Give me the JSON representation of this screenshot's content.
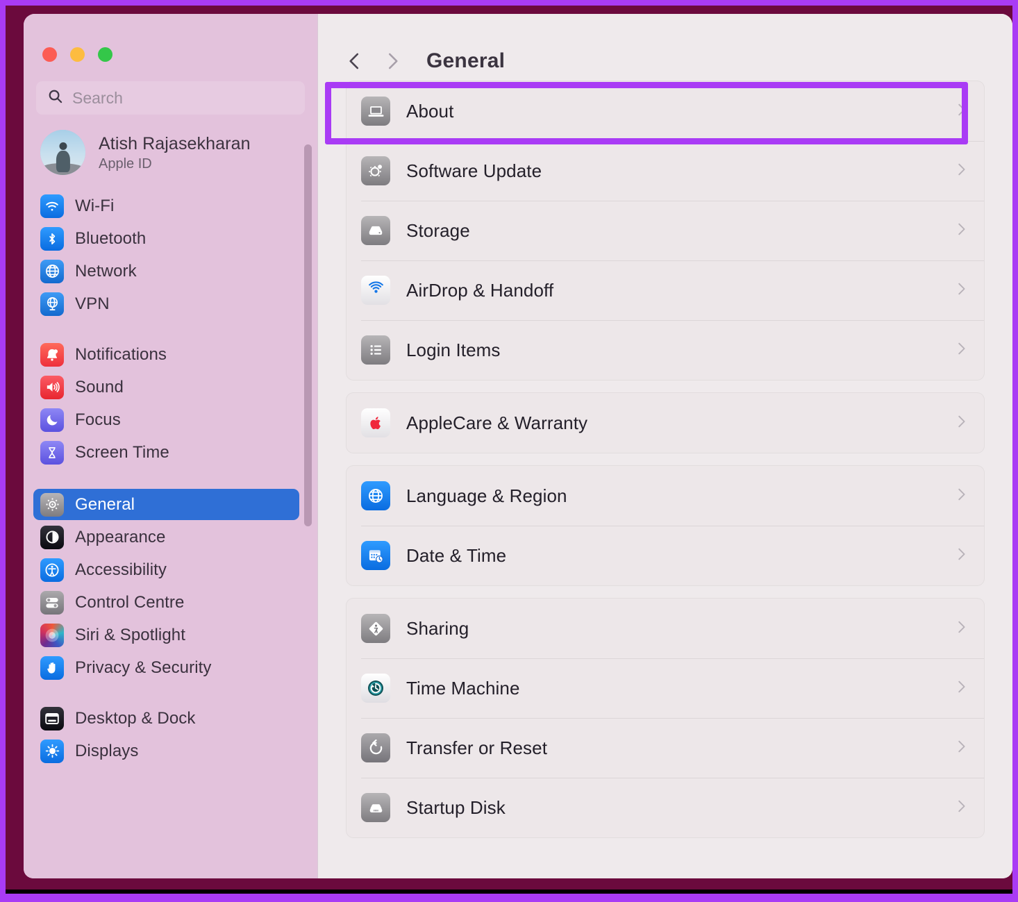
{
  "window": {
    "traffic_lights": [
      "close",
      "minimize",
      "zoom"
    ]
  },
  "sidebar": {
    "search": {
      "placeholder": "Search",
      "value": "",
      "icon": "search-icon"
    },
    "account": {
      "name": "Atish Rajasekharan",
      "subtitle": "Apple ID",
      "avatar_alt": "user-avatar"
    },
    "groups": [
      {
        "items": [
          {
            "label": "Wi-Fi",
            "icon": "wifi-icon"
          },
          {
            "label": "Bluetooth",
            "icon": "bluetooth-icon"
          },
          {
            "label": "Network",
            "icon": "globe-icon"
          },
          {
            "label": "VPN",
            "icon": "vpn-globe-icon"
          }
        ]
      },
      {
        "items": [
          {
            "label": "Notifications",
            "icon": "bell-icon"
          },
          {
            "label": "Sound",
            "icon": "speaker-icon"
          },
          {
            "label": "Focus",
            "icon": "moon-icon"
          },
          {
            "label": "Screen Time",
            "icon": "hourglass-icon"
          }
        ]
      },
      {
        "items": [
          {
            "label": "General",
            "icon": "gear-icon",
            "selected": true
          },
          {
            "label": "Appearance",
            "icon": "appearance-icon",
            "selected": false
          },
          {
            "label": "Accessibility",
            "icon": "accessibility-icon",
            "selected": false
          },
          {
            "label": "Control Centre",
            "icon": "toggles-icon",
            "selected": false
          },
          {
            "label": "Siri & Spotlight",
            "icon": "siri-icon",
            "selected": false
          },
          {
            "label": "Privacy & Security",
            "icon": "hand-icon",
            "selected": false
          }
        ]
      },
      {
        "items": [
          {
            "label": "Desktop & Dock",
            "icon": "desktop-dock-icon"
          },
          {
            "label": "Displays",
            "icon": "brightness-icon"
          }
        ]
      }
    ]
  },
  "main": {
    "back_icon": "chevron-left-icon",
    "forward_icon": "chevron-right-icon",
    "title": "General",
    "groups": [
      {
        "rows": [
          {
            "label": "About",
            "icon": "laptop-icon",
            "highlighted": true
          },
          {
            "label": "Software Update",
            "icon": "software-update-icon"
          },
          {
            "label": "Storage",
            "icon": "storage-icon"
          },
          {
            "label": "AirDrop & Handoff",
            "icon": "airdrop-icon"
          },
          {
            "label": "Login Items",
            "icon": "login-items-icon"
          }
        ]
      },
      {
        "rows": [
          {
            "label": "AppleCare & Warranty",
            "icon": "apple-logo-icon"
          }
        ]
      },
      {
        "rows": [
          {
            "label": "Language & Region",
            "icon": "language-globe-icon"
          },
          {
            "label": "Date & Time",
            "icon": "calendar-clock-icon"
          }
        ]
      },
      {
        "rows": [
          {
            "label": "Sharing",
            "icon": "sharing-icon"
          },
          {
            "label": "Time Machine",
            "icon": "time-machine-icon"
          },
          {
            "label": "Transfer or Reset",
            "icon": "reset-icon"
          },
          {
            "label": "Startup Disk",
            "icon": "startup-disk-icon"
          }
        ]
      }
    ],
    "row_chevron_icon": "chevron-right-icon"
  },
  "annotation": {
    "highlight_target": "About",
    "highlight_color": "#A93BF5"
  }
}
